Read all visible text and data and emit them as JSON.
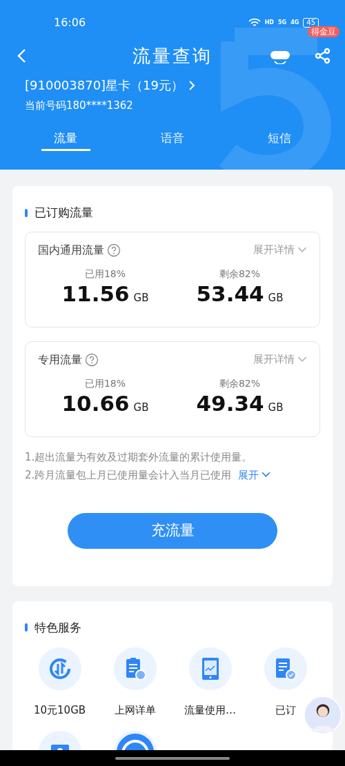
{
  "status_bar": {
    "time": "16:06",
    "indicators": [
      "HD",
      "5G",
      "4G"
    ],
    "battery": "45"
  },
  "header": {
    "title": "流量查询",
    "badge": "得金豆",
    "plan": "[910003870]星卡（19元）",
    "number": "当前号码180****1362"
  },
  "tabs": [
    {
      "label": "流量",
      "selected": true
    },
    {
      "label": "语音",
      "selected": false
    },
    {
      "label": "短信",
      "selected": false
    }
  ],
  "subscribed": {
    "title": "已订购流量",
    "pools": [
      {
        "name": "国内通用流量",
        "expand": "展开详情",
        "used_label": "已用18%",
        "used": "11.56",
        "used_unit": "GB",
        "remaining_label": "剩余82%",
        "remaining": "53.44",
        "remaining_unit": "GB"
      },
      {
        "name": "专用流量",
        "expand": "展开详情",
        "used_label": "已用18%",
        "used": "10.66",
        "used_unit": "GB",
        "remaining_label": "剩余82%",
        "remaining": "49.34",
        "remaining_unit": "GB"
      }
    ],
    "notes": [
      "1.超出流量为有效及过期套外流量的累计使用量。",
      "2.跨月流量包上月已使用量会计入当月已使用"
    ],
    "more": "展开",
    "button": "充流量"
  },
  "services": {
    "title": "特色服务",
    "items": [
      {
        "kind": "exchange",
        "label": "10元10GB"
      },
      {
        "kind": "bill",
        "label": "上网详单"
      },
      {
        "kind": "phone",
        "label": "流量使用…"
      },
      {
        "kind": "doc-check",
        "label": "已订"
      },
      {
        "kind": "contact"
      },
      {
        "kind": "globe"
      }
    ]
  }
}
